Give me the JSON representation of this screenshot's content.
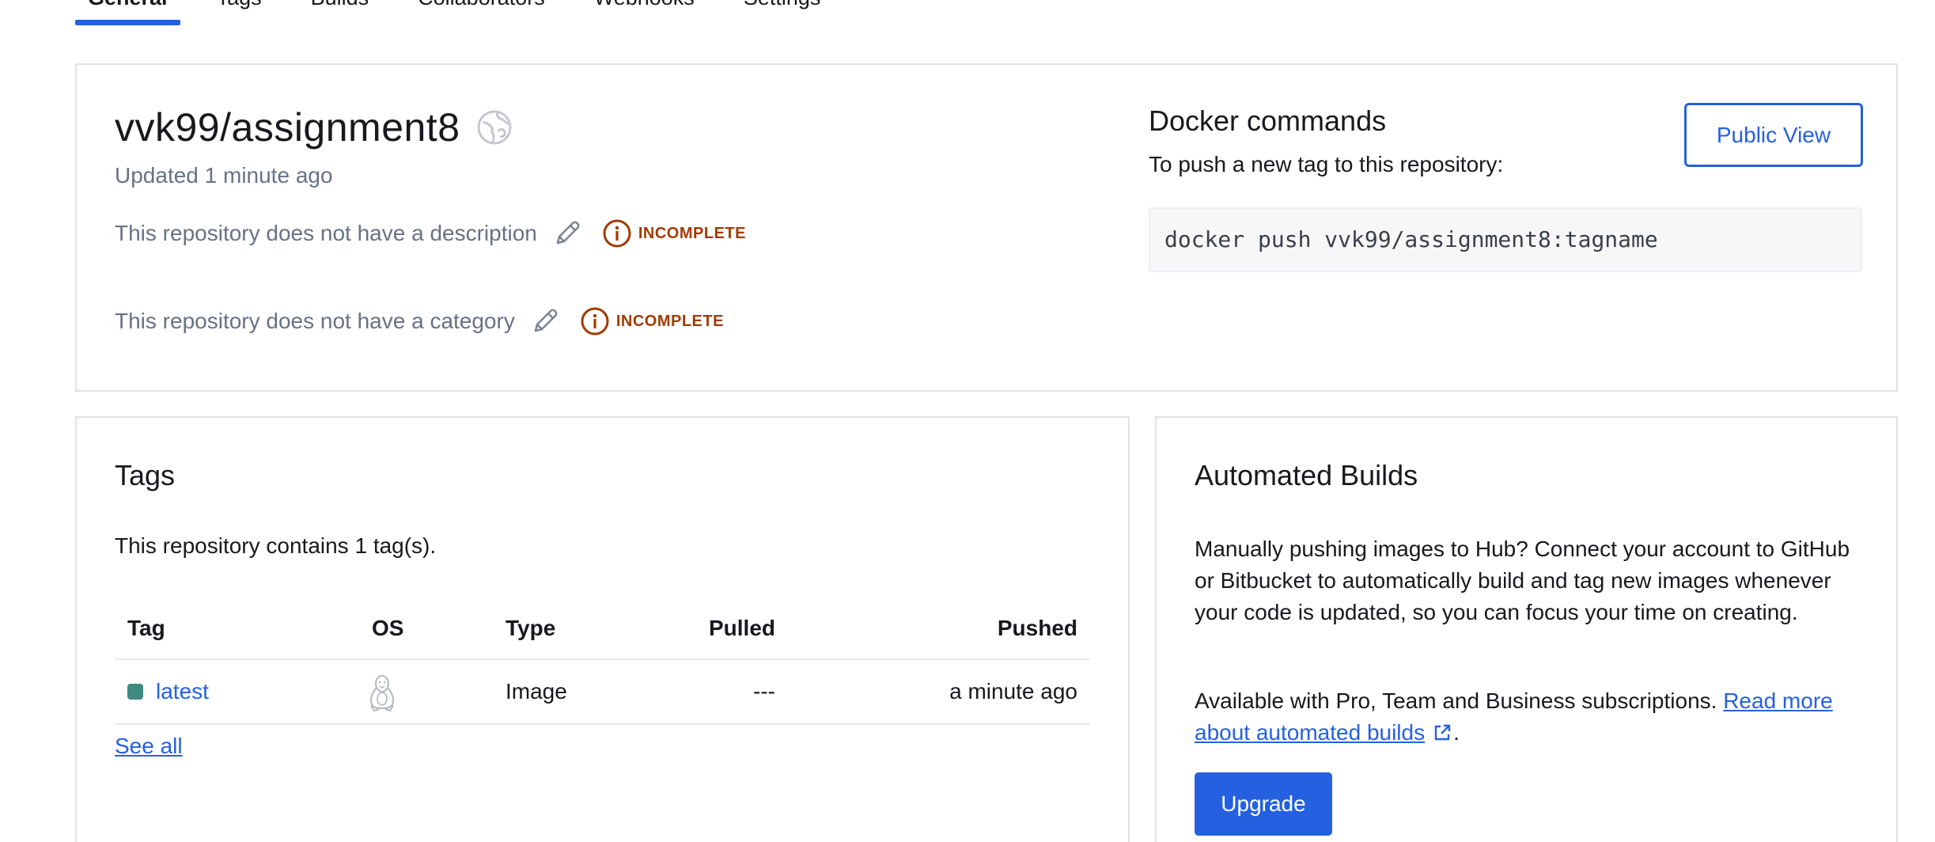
{
  "tabs": [
    {
      "label": "General",
      "active": true
    },
    {
      "label": "Tags"
    },
    {
      "label": "Builds"
    },
    {
      "label": "Collaborators"
    },
    {
      "label": "Webhooks"
    },
    {
      "label": "Settings"
    }
  ],
  "repo": {
    "name": "vvk99/assignment8",
    "visibility_icon": "public-globe-icon",
    "updated": "Updated 1 minute ago",
    "description_text": "This repository does not have a description",
    "category_text": "This repository does not have a category",
    "incomplete_label": "INCOMPLETE"
  },
  "docker": {
    "title": "Docker commands",
    "subtitle": "To push a new tag to this repository:",
    "command": "docker push vvk99/assignment8:tagname",
    "public_view_label": "Public View"
  },
  "tags_card": {
    "title": "Tags",
    "count_text": "This repository contains 1 tag(s).",
    "columns": [
      "Tag",
      "OS",
      "Type",
      "Pulled",
      "Pushed"
    ],
    "rows": [
      {
        "tag": "latest",
        "os_icon": "linux-icon",
        "type": "Image",
        "pulled": "---",
        "pushed": "a minute ago"
      }
    ],
    "see_all": "See all"
  },
  "automated_builds": {
    "title": "Automated Builds",
    "paragraph1": "Manually pushing images to Hub? Connect your account to GitHub or Bitbucket to automatically build and tag new images whenever your code is updated, so you can focus your time on creating.",
    "paragraph2": "Available with Pro, Team and Business subscriptions.",
    "read_more": "Read more about automated builds",
    "trailing": ".",
    "upgrade_label": "Upgrade"
  },
  "colors": {
    "accent": "#2560e0",
    "incomplete": "#a13b00",
    "muted_text": "#677285",
    "tag_status": "#3f8a82"
  }
}
